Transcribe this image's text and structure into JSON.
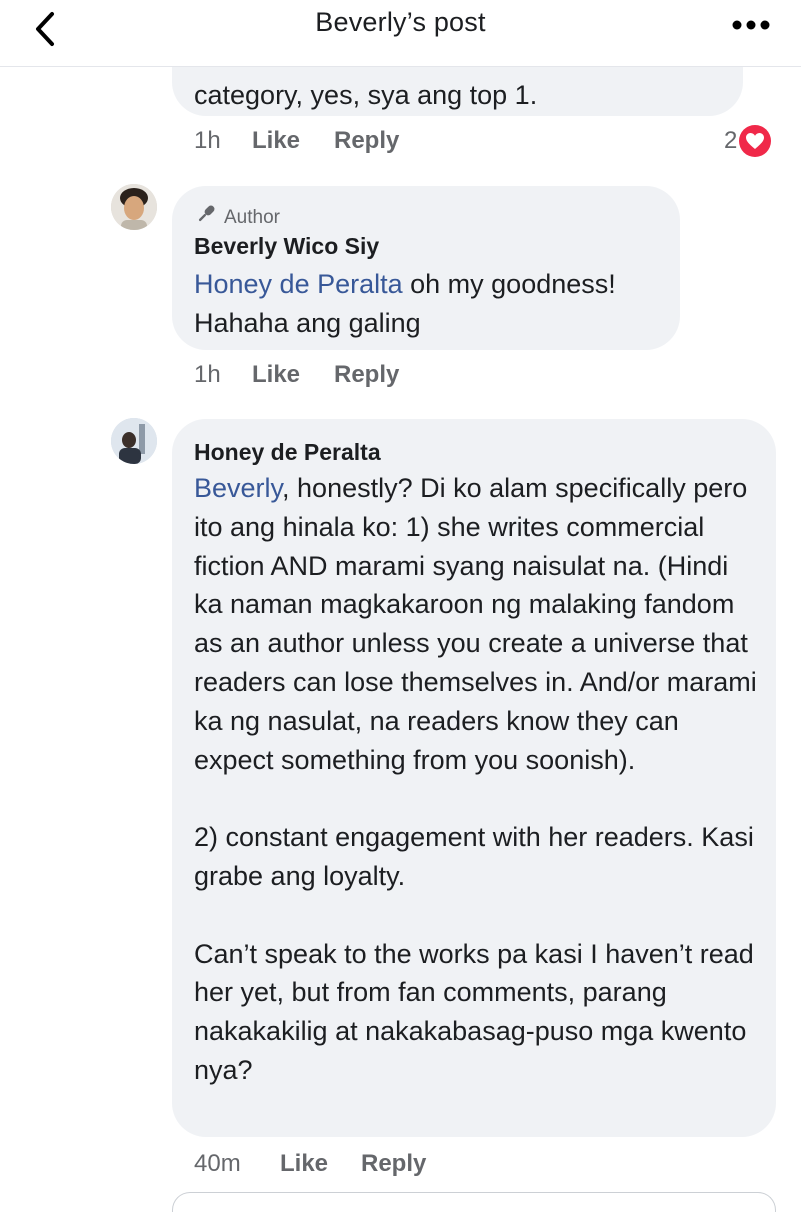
{
  "header": {
    "title": "Beverly’s post"
  },
  "comments": [
    {
      "text": "category, yes, sya ang top 1.",
      "time": "1h",
      "like": "Like",
      "reply": "Reply",
      "reactions": {
        "count": "2"
      }
    },
    {
      "badge": "Author",
      "name": "Beverly Wico Siy",
      "mention": "Honey de Peralta",
      "text_after_mention": " oh my goodness!",
      "text_line2": "Hahaha ang galing",
      "time": "1h",
      "like": "Like",
      "reply": "Reply"
    },
    {
      "name": "Honey de Peralta",
      "mention": "Beverly",
      "para1_after_mention": ", honestly? Di ko alam specifically pero ito ang hinala ko: 1) she writes commercial fiction AND marami syang naisulat na. (Hindi ka naman magkakaroon ng malaking fandom as an author unless you create a universe that readers can lose themselves in. And/or marami ka ng nasulat, na readers know they can expect something from you soonish).",
      "para2": "2) constant engagement with her readers. Kasi grabe ang loyalty.",
      "para3": "Can’t speak to the works pa kasi I haven’t read her yet, but from fan comments, parang nakakakilig at nakakabasag-puso mga kwento nya?",
      "time": "40m",
      "like": "Like",
      "reply": "Reply"
    }
  ],
  "colors": {
    "bubble": "#f0f2f5",
    "mention": "#385898",
    "meta": "#65676b",
    "heart": "#f02849"
  }
}
